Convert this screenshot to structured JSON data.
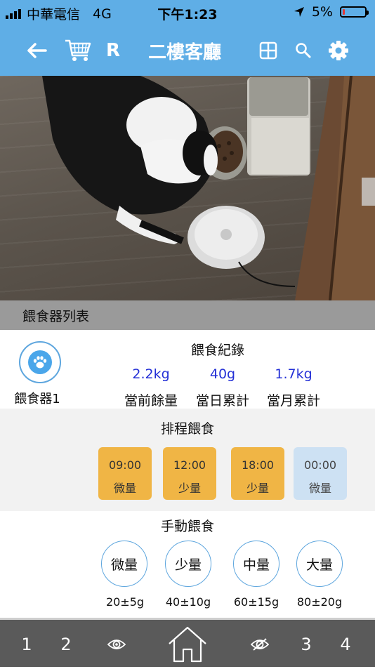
{
  "status": {
    "carrier": "中華電信",
    "network": "4G",
    "time": "下午1:23",
    "battery": "5%",
    "battery_level": 0.05
  },
  "nav": {
    "back_icon": "arrow-left-icon",
    "cart_icon": "cart-icon",
    "r_label": "R",
    "title": "二樓客廳",
    "grid_icon": "grid-icon",
    "search_icon": "search-icon",
    "settings_icon": "gear-icon"
  },
  "list_header": "餵食器列表",
  "feeder": {
    "name": "餵食器1",
    "icon": "paw-icon",
    "record_title": "餵食紀錄",
    "records": [
      {
        "value": "2.2kg",
        "label": "當前餘量"
      },
      {
        "value": "40g",
        "label": "當日累計"
      },
      {
        "value": "1.7kg",
        "label": "當月累計"
      }
    ]
  },
  "schedule": {
    "title": "排程餵食",
    "items": [
      {
        "time": "09:00",
        "amount": "微量",
        "active": true
      },
      {
        "time": "12:00",
        "amount": "少量",
        "active": true
      },
      {
        "time": "18:00",
        "amount": "少量",
        "active": true
      },
      {
        "time": "00:00",
        "amount": "微量",
        "active": false
      }
    ]
  },
  "manual": {
    "title": "手動餵食",
    "items": [
      {
        "label": "微量",
        "range": "20±5g"
      },
      {
        "label": "少量",
        "range": "40±10g"
      },
      {
        "label": "中量",
        "range": "60±15g"
      },
      {
        "label": "大量",
        "range": "80±20g"
      }
    ]
  },
  "tabbar": {
    "tab1": "1",
    "tab2": "2",
    "tab3": "3",
    "tab4": "4",
    "eye_icon": "eye-icon",
    "home_icon": "home-icon",
    "eye_off_icon": "eye-off-icon"
  },
  "colors": {
    "primary": "#5faee6",
    "schedule_active": "#f0b545",
    "schedule_inactive": "#cde1f3",
    "value_text": "#2430d6",
    "tabbar": "#5a5a5a"
  }
}
